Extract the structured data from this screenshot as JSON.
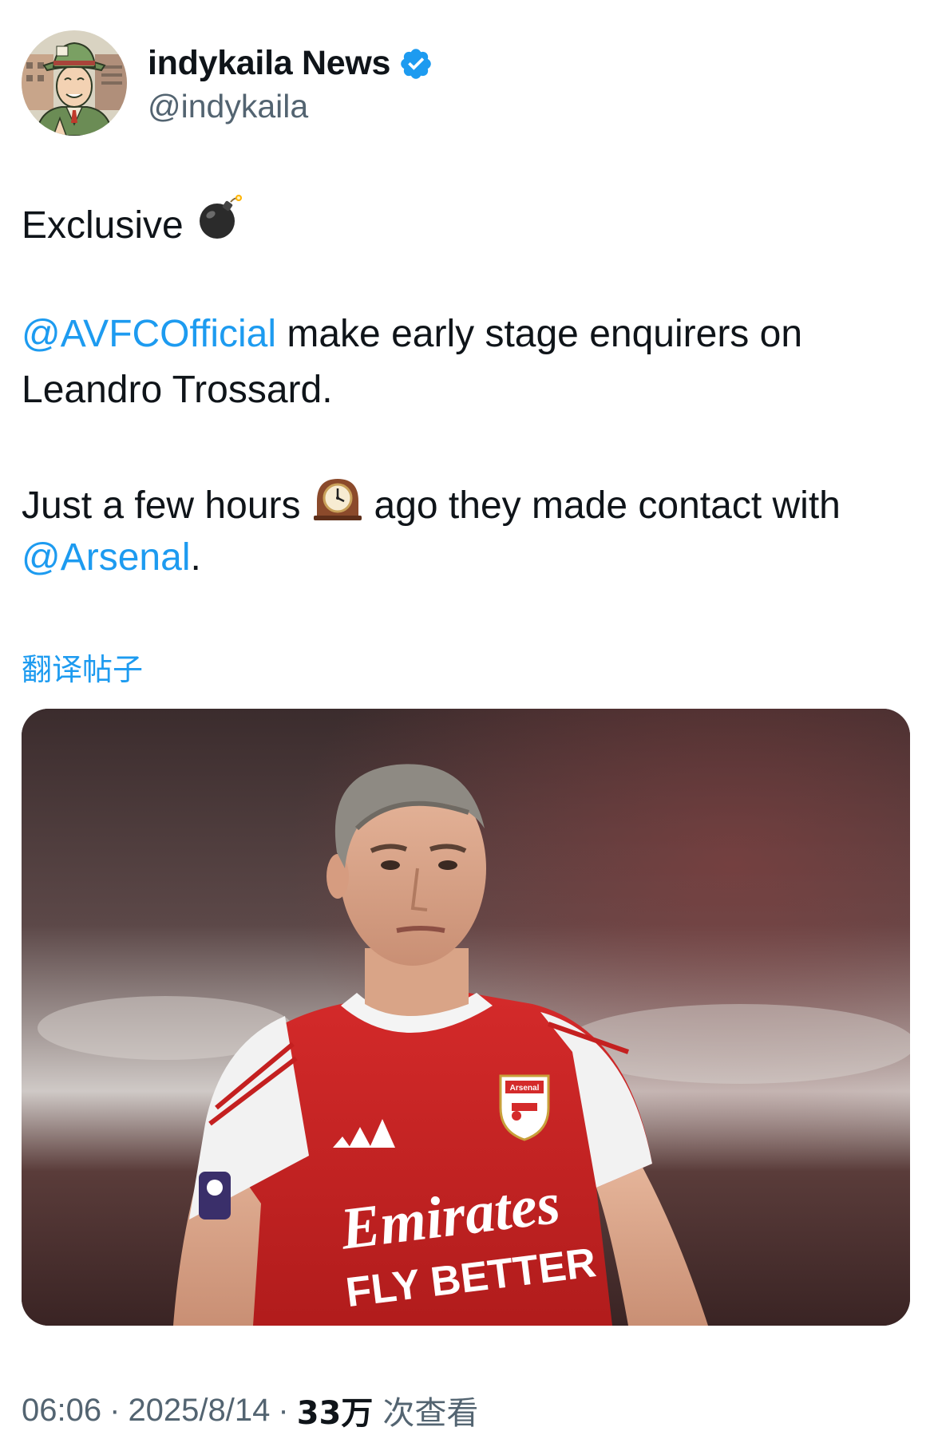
{
  "author": {
    "display_name": "indykaila News",
    "handle": "@indykaila",
    "verified": true,
    "avatar_icon": "cartoon-reporter-avatar"
  },
  "tweet": {
    "line1_text": "Exclusive",
    "line1_emoji": "bomb-emoji",
    "mention1": "@AVFCOfficial",
    "line2_rest": " make early stage enquirers on",
    "line3_text": "Leandro Trossard.",
    "line4_pre": "Just a few hours",
    "line4_emoji": "mantelpiece-clock-emoji",
    "line4_post": "ago they made contact with",
    "mention2": "@Arsenal",
    "line5_end": "."
  },
  "translate_label": "翻译帖子",
  "media": {
    "kind": "photo",
    "jersey_sponsor_line1": "Emirates",
    "jersey_sponsor_line2": "FLY BETTER",
    "crest_text": "Arsenal"
  },
  "meta": {
    "time": "06:06",
    "separator": "·",
    "date": "2025/8/14",
    "views_count": "33万",
    "views_label": "次查看"
  },
  "colors": {
    "link": "#1d9bf0",
    "secondary_text": "#536471",
    "primary_text": "#0f1419"
  }
}
